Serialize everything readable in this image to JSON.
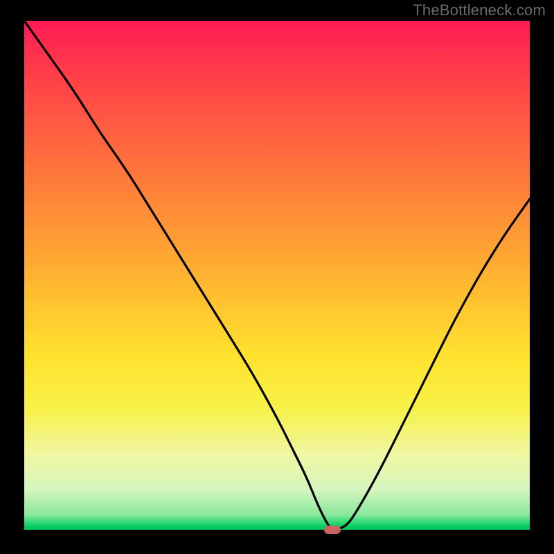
{
  "watermark": {
    "text": "TheBottleneck.com"
  },
  "colors": {
    "background": "#000000",
    "curve": "#000000",
    "marker": "#c9645e",
    "green_base": "#05c85f"
  },
  "chart_data": {
    "type": "line",
    "title": "",
    "xlabel": "",
    "ylabel": "",
    "xlim": [
      0,
      100
    ],
    "ylim": [
      0,
      100
    ],
    "grid": false,
    "legend": null,
    "annotations": [
      {
        "kind": "marker",
        "shape": "rounded-rect",
        "x": 61,
        "y": 0,
        "color": "#c9645e"
      }
    ],
    "series": [
      {
        "name": "bottleneck-curve",
        "x": [
          0,
          5,
          10,
          15,
          20,
          25,
          30,
          35,
          40,
          45,
          50,
          53,
          56,
          58,
          60,
          61,
          62,
          64,
          66,
          70,
          75,
          80,
          85,
          90,
          95,
          100
        ],
        "y": [
          100,
          93,
          86,
          78,
          71,
          63,
          55,
          47,
          39,
          31,
          22,
          16,
          10,
          5,
          1,
          0,
          0,
          1,
          4,
          11,
          21,
          31,
          41,
          50,
          58,
          65
        ]
      }
    ]
  }
}
